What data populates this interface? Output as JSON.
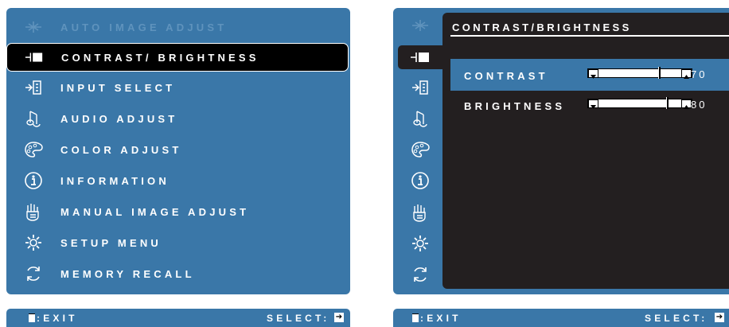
{
  "left_menu": {
    "items": [
      {
        "label": "AUTO IMAGE ADJUST",
        "icon": "auto-adjust-icon"
      },
      {
        "label": "CONTRAST/ BRIGHTNESS",
        "icon": "contrast-icon"
      },
      {
        "label": "INPUT SELECT",
        "icon": "input-icon"
      },
      {
        "label": "AUDIO ADJUST",
        "icon": "audio-icon"
      },
      {
        "label": "COLOR ADJUST",
        "icon": "color-icon"
      },
      {
        "label": "INFORMATION",
        "icon": "info-icon"
      },
      {
        "label": "MANUAL IMAGE ADJUST",
        "icon": "manual-adjust-icon"
      },
      {
        "label": "SETUP MENU",
        "icon": "gear-icon"
      },
      {
        "label": "MEMORY RECALL",
        "icon": "recall-icon"
      }
    ],
    "exit_label": ":EXIT",
    "select_label": "SELECT:"
  },
  "right_menu": {
    "title": "CONTRAST/BRIGHTNESS",
    "contrast": {
      "label": "CONTRAST",
      "value": "70",
      "level": 0.7
    },
    "brightness": {
      "label": "BRIGHTNESS",
      "value": "80",
      "level": 0.8
    },
    "exit_label": ":EXIT",
    "select_label": "SELECT:"
  },
  "colors": {
    "panel": "#3a77a8",
    "dark": "#231f20"
  }
}
